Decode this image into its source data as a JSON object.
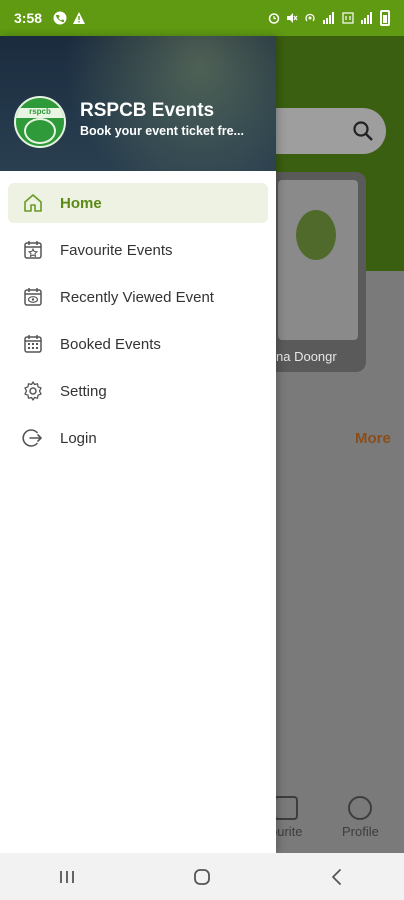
{
  "status_bar": {
    "time": "3:58"
  },
  "background": {
    "card_title": "na Doongr",
    "more_label": "More",
    "bottom_nav": {
      "favourite_label": "ourite",
      "profile_label": "Profile"
    }
  },
  "drawer": {
    "app_title": "RSPCB Events",
    "app_subtitle": "Book your event ticket fre...",
    "logo_text": "rspcb",
    "menu": [
      {
        "label": "Home",
        "icon": "home-icon",
        "active": true
      },
      {
        "label": "Favourite Events",
        "icon": "calendar-star-icon",
        "active": false
      },
      {
        "label": "Recently Viewed Event",
        "icon": "calendar-eye-icon",
        "active": false
      },
      {
        "label": "Booked Events",
        "icon": "calendar-grid-icon",
        "active": false
      },
      {
        "label": "Setting",
        "icon": "gear-icon",
        "active": false
      },
      {
        "label": "Login",
        "icon": "login-icon",
        "active": false
      }
    ]
  },
  "colors": {
    "accent_green": "#5f9a12",
    "active_bg": "#edf2e2",
    "header_bg": "#1b2b3e"
  }
}
